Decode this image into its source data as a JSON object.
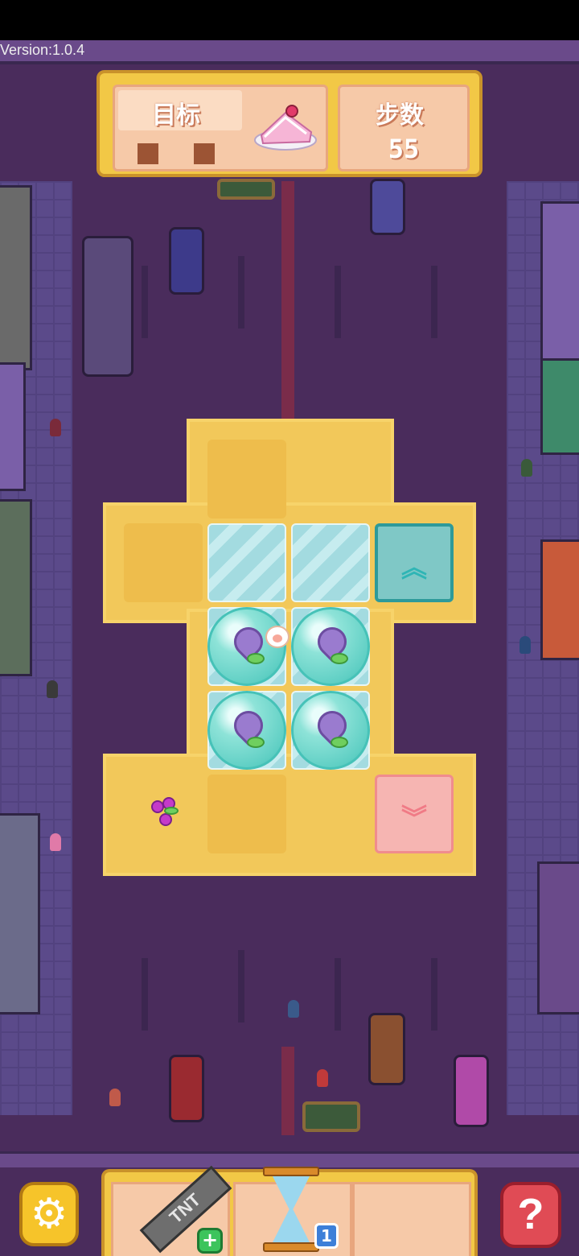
{
  "version_text": "Version:1.0.4",
  "hud": {
    "goal_label": "目标",
    "goal_item_icon": "cake-icon",
    "steps_label": "步数",
    "steps_value": "55"
  },
  "board": {
    "tiles": [
      "sand",
      "glass",
      "glass",
      "teal-up-box",
      "bubble-flower",
      "bubble-flower",
      "bubble-flower",
      "bubble-flower",
      "pink-down-box",
      "berry-flower"
    ],
    "up_arrow": "︽",
    "down_arrow": "︾"
  },
  "boosters": {
    "tnt_label": "TNT",
    "tnt_badge": "+",
    "hourglass_count": "1"
  },
  "buttons": {
    "settings_icon": "gear-icon",
    "help_label": "?"
  },
  "colors": {
    "background": "#4a2c5c",
    "board": "#f2c85a",
    "hud_frame": "#f2c846",
    "teal_box": "#7fc8c6",
    "pink_box": "#f6b5b2"
  }
}
